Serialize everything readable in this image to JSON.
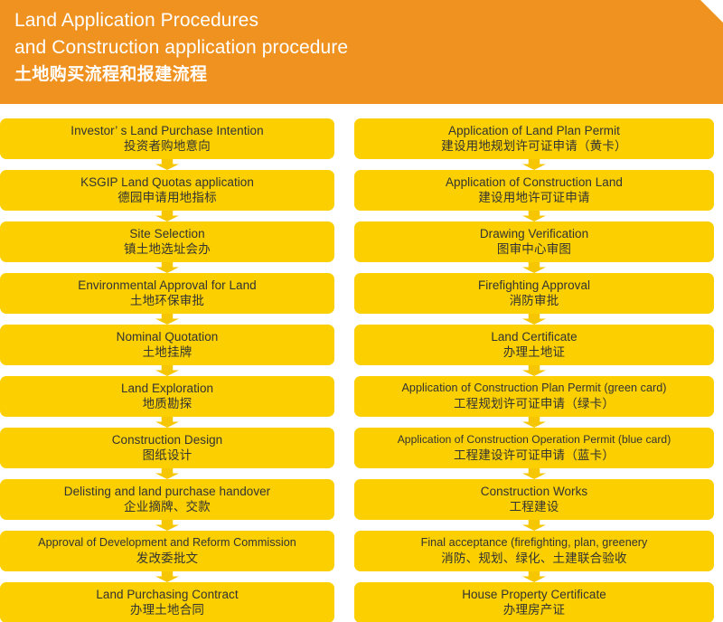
{
  "header": {
    "title_line1": "Land Application Procedures",
    "title_line2": "and Construction application procedure",
    "title_cn": "土地购买流程和报建流程",
    "background_color": "#ef9220",
    "text_color": "#ffffff"
  },
  "theme": {
    "node_fill": "#fbcf00",
    "arrow_fill": "#f6c600",
    "node_text": "#333333",
    "page_background": "#ffffff"
  },
  "chart_data": {
    "type": "diagram",
    "diagram_kind": "flowchart",
    "title": "Land Application Procedures and Construction application procedure",
    "title_cn": "土地购买流程和报建流程",
    "columns": 2,
    "connector": "down-arrow",
    "left_column_label": "Land Application Procedures",
    "right_column_label": "Construction application procedure"
  },
  "left_column": {
    "name": "land-application-procedures",
    "nodes": [
      {
        "en": "Investor’ s Land Purchase Intention",
        "cn": "投资者购地意向"
      },
      {
        "en": "KSGIP Land Quotas application",
        "cn": "德园申请用地指标"
      },
      {
        "en": "Site Selection",
        "cn": "镇土地选址会办"
      },
      {
        "en": "Environmental Approval for Land",
        "cn": "土地环保审批"
      },
      {
        "en": "Nominal Quotation",
        "cn": "土地挂牌"
      },
      {
        "en": "Land Exploration",
        "cn": "地质勘探"
      },
      {
        "en": "Construction Design",
        "cn": "图纸设计"
      },
      {
        "en": "Delisting and land purchase handover",
        "cn": "企业摘牌、交款"
      },
      {
        "en": "Approval of Development and Reform Commission",
        "cn": "发改委批文"
      },
      {
        "en": "Land Purchasing Contract",
        "cn": "办理土地合同"
      }
    ]
  },
  "right_column": {
    "name": "construction-application-procedure",
    "nodes": [
      {
        "en": "Application of Land Plan Permit",
        "cn": "建设用地规划许可证申请（黄卡）"
      },
      {
        "en": "Application of Construction Land",
        "cn": "建设用地许可证申请"
      },
      {
        "en": "Drawing Verification",
        "cn": "图审中心审图"
      },
      {
        "en": "Firefighting Approval",
        "cn": "消防审批"
      },
      {
        "en": "Land Certificate",
        "cn": "办理土地证"
      },
      {
        "en": "Application of Construction Plan Permit (green card)",
        "cn": "工程规划许可证申请（绿卡）"
      },
      {
        "en": "Application of Construction Operation Permit (blue card)",
        "cn": "工程建设许可证申请（蓝卡）"
      },
      {
        "en": "Construction Works",
        "cn": "工程建设"
      },
      {
        "en": "Final acceptance (firefighting, plan, greenery",
        "cn": "消防、规划、绿化、土建联合验收"
      },
      {
        "en": "House Property Certificate",
        "cn": "办理房产证"
      }
    ]
  }
}
